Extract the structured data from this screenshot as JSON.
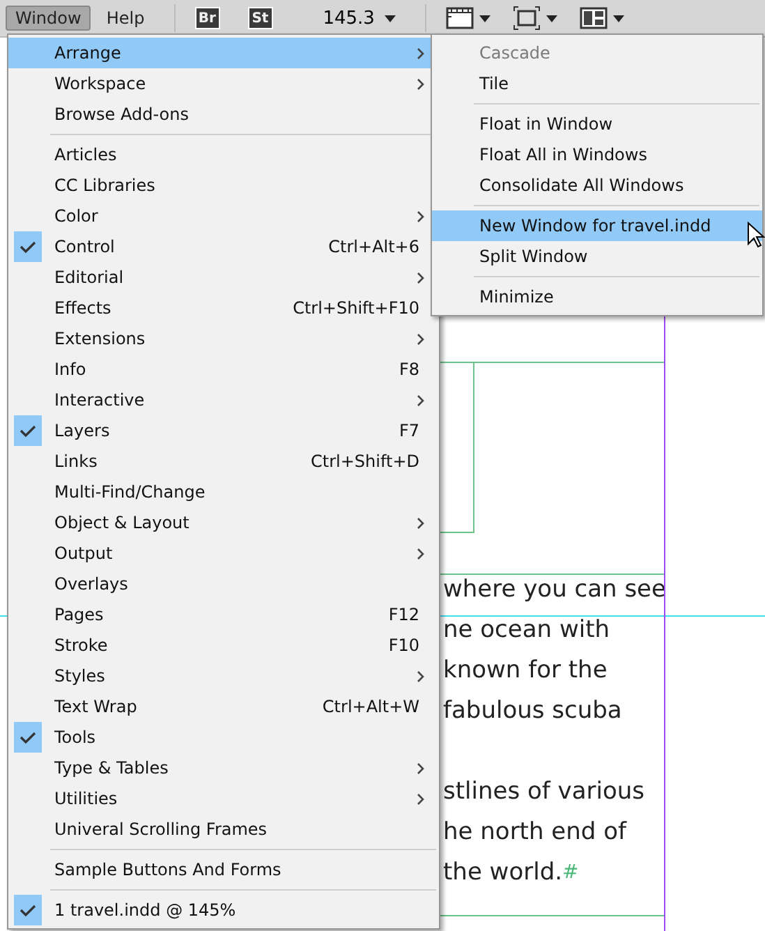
{
  "menubar": {
    "menus": [
      {
        "label": "Window",
        "selected": true
      },
      {
        "label": "Help",
        "selected": false
      }
    ],
    "badges": [
      "Br",
      "St"
    ],
    "zoom": "145.3"
  },
  "document": {
    "paragraphs": [
      [
        "where you can see",
        "ne ocean with",
        "known for the",
        "fabulous scuba"
      ],
      [
        "stlines of various",
        "he north end of",
        "the world."
      ]
    ],
    "end_mark": "#"
  },
  "menu": {
    "items": [
      {
        "kind": "item",
        "label": "Arrange",
        "submenu": true,
        "selected": true,
        "checked": false
      },
      {
        "kind": "item",
        "label": "Workspace",
        "submenu": true,
        "selected": false,
        "checked": false
      },
      {
        "kind": "item",
        "label": "Browse Add-ons",
        "selected": false,
        "checked": false
      },
      {
        "kind": "separator"
      },
      {
        "kind": "item",
        "label": "Articles",
        "selected": false,
        "checked": false
      },
      {
        "kind": "item",
        "label": "CC Libraries",
        "selected": false,
        "checked": false
      },
      {
        "kind": "item",
        "label": "Color",
        "submenu": true,
        "selected": false,
        "checked": false
      },
      {
        "kind": "item",
        "label": "Control",
        "shortcut": "Ctrl+Alt+6",
        "selected": false,
        "checked": true
      },
      {
        "kind": "item",
        "label": "Editorial",
        "submenu": true,
        "selected": false,
        "checked": false
      },
      {
        "kind": "item",
        "label": "Effects",
        "shortcut": "Ctrl+Shift+F10",
        "selected": false,
        "checked": false
      },
      {
        "kind": "item",
        "label": "Extensions",
        "submenu": true,
        "selected": false,
        "checked": false
      },
      {
        "kind": "item",
        "label": "Info",
        "shortcut": "F8",
        "selected": false,
        "checked": false
      },
      {
        "kind": "item",
        "label": "Interactive",
        "submenu": true,
        "selected": false,
        "checked": false
      },
      {
        "kind": "item",
        "label": "Layers",
        "shortcut": "F7",
        "selected": false,
        "checked": true
      },
      {
        "kind": "item",
        "label": "Links",
        "shortcut": "Ctrl+Shift+D",
        "selected": false,
        "checked": false
      },
      {
        "kind": "item",
        "label": "Multi-Find/Change",
        "selected": false,
        "checked": false
      },
      {
        "kind": "item",
        "label": "Object & Layout",
        "submenu": true,
        "selected": false,
        "checked": false
      },
      {
        "kind": "item",
        "label": "Output",
        "submenu": true,
        "selected": false,
        "checked": false
      },
      {
        "kind": "item",
        "label": "Overlays",
        "selected": false,
        "checked": false
      },
      {
        "kind": "item",
        "label": "Pages",
        "shortcut": "F12",
        "selected": false,
        "checked": false
      },
      {
        "kind": "item",
        "label": "Stroke",
        "shortcut": "F10",
        "selected": false,
        "checked": false
      },
      {
        "kind": "item",
        "label": "Styles",
        "submenu": true,
        "selected": false,
        "checked": false
      },
      {
        "kind": "item",
        "label": "Text Wrap",
        "shortcut": "Ctrl+Alt+W",
        "selected": false,
        "checked": false
      },
      {
        "kind": "item",
        "label": "Tools",
        "selected": false,
        "checked": true
      },
      {
        "kind": "item",
        "label": "Type & Tables",
        "submenu": true,
        "selected": false,
        "checked": false
      },
      {
        "kind": "item",
        "label": "Utilities",
        "submenu": true,
        "selected": false,
        "checked": false
      },
      {
        "kind": "item",
        "label": "Univeral Scrolling Frames",
        "selected": false,
        "checked": false
      },
      {
        "kind": "separator"
      },
      {
        "kind": "item",
        "label": "Sample Buttons And Forms",
        "selected": false,
        "checked": false
      },
      {
        "kind": "separator"
      },
      {
        "kind": "item",
        "label": "1 travel.indd @ 145%",
        "selected": false,
        "checked": true
      }
    ]
  },
  "submenu": {
    "items": [
      {
        "kind": "item",
        "label": "Cascade",
        "disabled": true,
        "selected": false
      },
      {
        "kind": "item",
        "label": "Tile",
        "disabled": false,
        "selected": false
      },
      {
        "kind": "separator"
      },
      {
        "kind": "item",
        "label": "Float in Window",
        "disabled": false,
        "selected": false
      },
      {
        "kind": "item",
        "label": "Float All in Windows",
        "disabled": false,
        "selected": false
      },
      {
        "kind": "item",
        "label": "Consolidate All Windows",
        "disabled": false,
        "selected": false
      },
      {
        "kind": "separator"
      },
      {
        "kind": "item",
        "label": "New Window for travel.indd",
        "disabled": false,
        "selected": true
      },
      {
        "kind": "item",
        "label": "Split Window",
        "disabled": false,
        "selected": false
      },
      {
        "kind": "separator"
      },
      {
        "kind": "item",
        "label": "Minimize",
        "disabled": false,
        "selected": false
      }
    ]
  }
}
